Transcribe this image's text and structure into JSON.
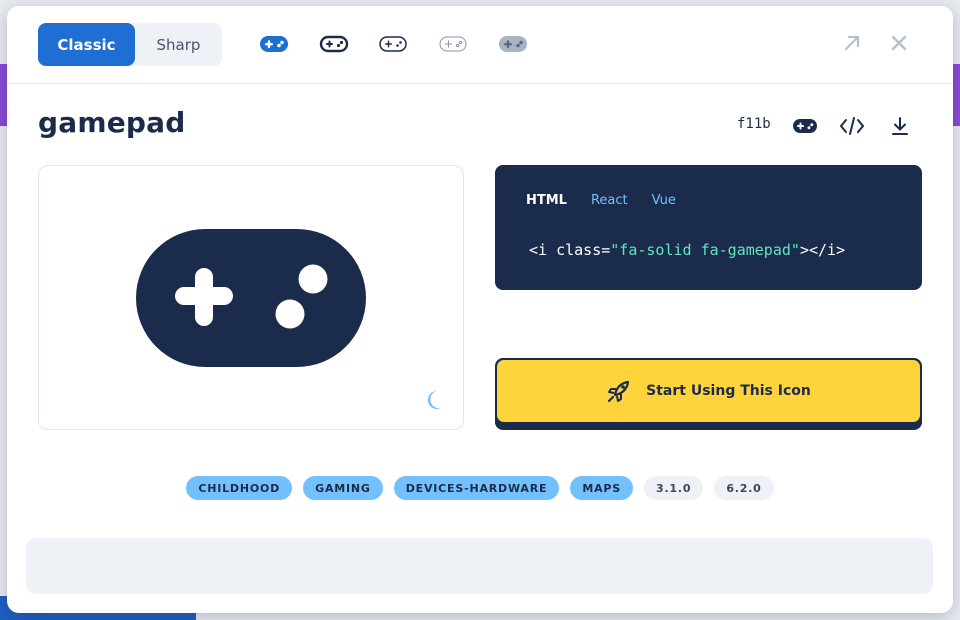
{
  "style_toggle": {
    "classic": "Classic",
    "sharp": "Sharp"
  },
  "style_variants": [
    "solid",
    "regular",
    "light",
    "thin",
    "duotone"
  ],
  "icon": {
    "name": "gamepad",
    "unicode": "f11b"
  },
  "code": {
    "tabs": [
      "HTML",
      "React",
      "Vue"
    ],
    "prefix": "<i class=",
    "value": "\"fa-solid fa-gamepad\"",
    "suffix": "></i>"
  },
  "cta": {
    "label": "Start Using This Icon"
  },
  "tags": [
    {
      "label": "CHILDHOOD",
      "kind": "category"
    },
    {
      "label": "GAMING",
      "kind": "category"
    },
    {
      "label": "DEVICES-HARDWARE",
      "kind": "category"
    },
    {
      "label": "MAPS",
      "kind": "category"
    },
    {
      "label": "3.1.0",
      "kind": "version"
    },
    {
      "label": "6.2.0",
      "kind": "version"
    }
  ],
  "colors": {
    "navy": "#1b2b4b",
    "accent": "#1e6ed3",
    "yellow": "#ffd43b",
    "tag_blue": "#74c0fc"
  }
}
